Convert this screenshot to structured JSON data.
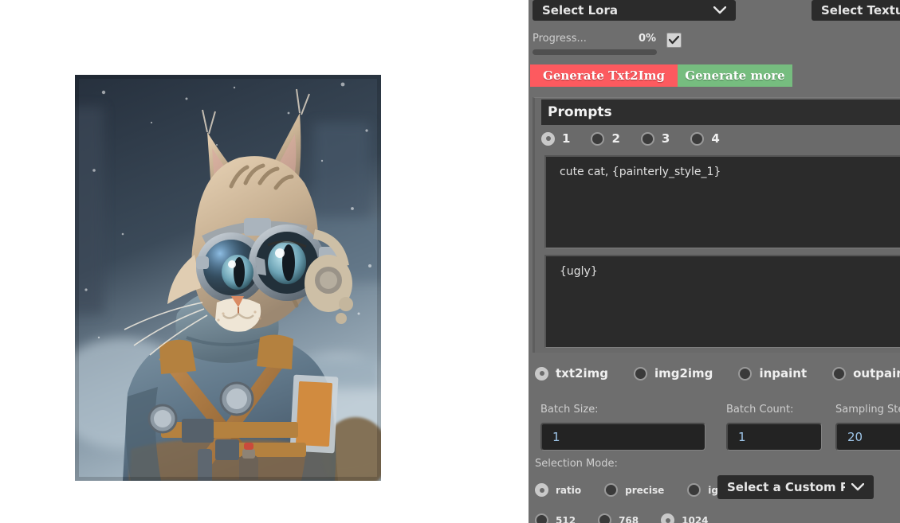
{
  "app": {
    "panel_bg": "#6e6e6e",
    "field_bg": "#2b2b2b",
    "accent_generate": "#fd5a5f",
    "accent_generate_more": "#76bd7f",
    "value_text_color": "#9ec5e8"
  },
  "preview": {
    "image_alt": "cute cat, painterly style — steampunk aviator tabby cat wearing goggles, scarf and blue winter coat in snow"
  },
  "toolbar": {
    "lora_dropdown": "Select Lora",
    "textual_dropdown": "Select Textual",
    "chevron_icon": "chevron-down-icon"
  },
  "progress": {
    "label": "Progress...",
    "percent": "0%",
    "value": 0,
    "checkbox_checked": true,
    "check_icon": "check-icon"
  },
  "actions": {
    "generate": "Generate Txt2Img",
    "generate_more": "Generate more"
  },
  "prompts": {
    "title": "Prompts",
    "indices": [
      {
        "label": "1",
        "selected": true
      },
      {
        "label": "2",
        "selected": false
      },
      {
        "label": "3",
        "selected": false
      },
      {
        "label": "4",
        "selected": false
      }
    ],
    "positive": "cute cat, {painterly_style_1}",
    "negative": "{ugly}"
  },
  "modes": [
    {
      "label": "txt2img",
      "selected": true
    },
    {
      "label": "img2img",
      "selected": false
    },
    {
      "label": "inpaint",
      "selected": false
    },
    {
      "label": "outpaint",
      "selected": false
    }
  ],
  "batch": {
    "size_label": "Batch Size:",
    "size_value": "1",
    "count_label": "Batch Count:",
    "count_value": "1",
    "steps_label": "Sampling Ste",
    "steps_value": "20"
  },
  "selection": {
    "label": "Selection Mode:",
    "modes": [
      {
        "label": "ratio",
        "selected": true
      },
      {
        "label": "precise",
        "selected": false
      },
      {
        "label": "ignore",
        "selected": false
      }
    ],
    "preset_dropdown": "Select a Custom Preset"
  },
  "resolutions": [
    {
      "label": "512",
      "selected": false
    },
    {
      "label": "768",
      "selected": false
    },
    {
      "label": "1024",
      "selected": true
    }
  ]
}
